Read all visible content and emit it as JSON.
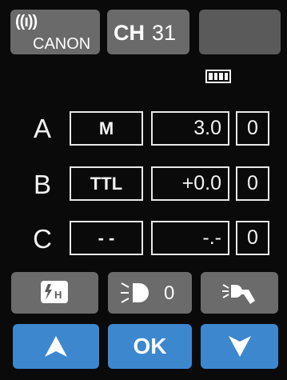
{
  "header": {
    "wireless_label": "((ı))",
    "brand": "CANON",
    "channel_label": "CH",
    "channel_value": "31",
    "blank_button": ""
  },
  "battery": {
    "level": 1.0,
    "bars": 4,
    "icon": "battery-icon"
  },
  "groups": [
    {
      "letter": "A",
      "mode": "M",
      "power": "3.0",
      "flash": "0"
    },
    {
      "letter": "B",
      "mode": "TTL",
      "power": "+0.0",
      "flash": "0"
    },
    {
      "letter": "C",
      "mode": "- -",
      "power": "-.-",
      "flash": "0"
    }
  ],
  "controls": {
    "hss_icon": "high-speed-sync-icon",
    "modeling_light_icon": "modeling-light-icon",
    "modeling_light_value": "0",
    "lamp_icon": "lamp-icon"
  },
  "navigation": {
    "up_icon": "up-arrow-icon",
    "ok_label": "OK",
    "down_icon": "down-arrow-icon"
  },
  "colors": {
    "background": "#0a0a0a",
    "gray_button": "#6b6b6b",
    "blue_button": "#3d87cf",
    "text": "#f3f3f3"
  }
}
